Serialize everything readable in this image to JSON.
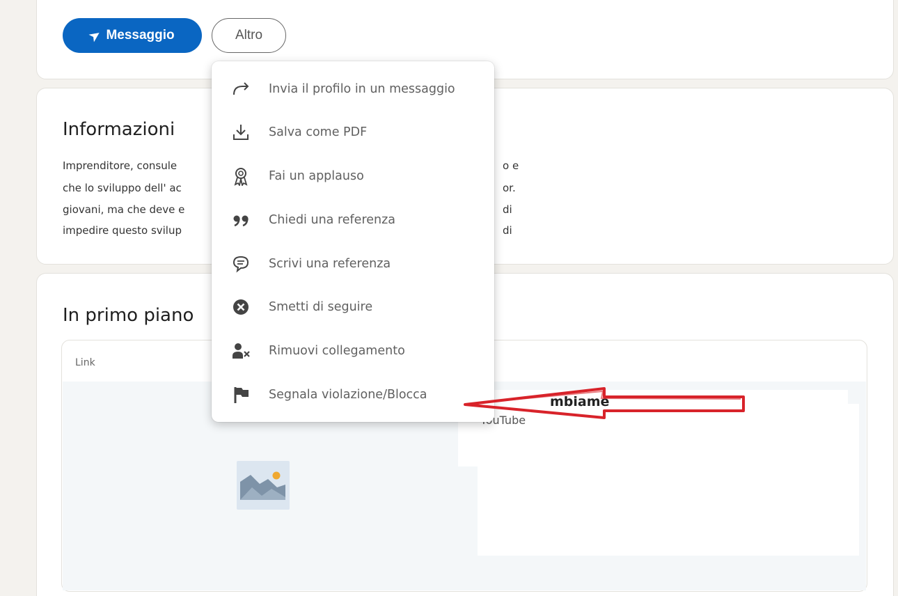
{
  "profile_actions": {
    "message_label": "Messaggio",
    "more_label": "Altro"
  },
  "about": {
    "title": "Informazioni",
    "lines_left": [
      "Imprenditore, consule",
      "che lo sviluppo dell' ac",
      "giovani, ma che deve e",
      "impedire questo svilup"
    ],
    "lines_right": [
      "o e",
      "or.",
      "di",
      "di"
    ]
  },
  "featured": {
    "title": "In primo piano",
    "card_label": "Link",
    "link_title": "mbiame",
    "link_source": "YouTube"
  },
  "more_menu": {
    "items": [
      {
        "label": "Invia il profilo in un messaggio",
        "icon": "share-arrow-icon"
      },
      {
        "label": "Salva come PDF",
        "icon": "download-icon"
      },
      {
        "label": "Fai un applauso",
        "icon": "award-ribbon-icon"
      },
      {
        "label": "Chiedi una referenza",
        "icon": "quote-icon"
      },
      {
        "label": "Scrivi una referenza",
        "icon": "speech-bubble-icon"
      },
      {
        "label": "Smetti di seguire",
        "icon": "close-circle-icon"
      },
      {
        "label": "Rimuovi collegamento",
        "icon": "remove-person-icon"
      },
      {
        "label": "Segnala violazione/Blocca",
        "icon": "flag-icon"
      }
    ]
  },
  "colors": {
    "primary_blue": "#0a66c2",
    "annotation_red": "#d8232a",
    "page_bg": "#f4f2ee"
  }
}
